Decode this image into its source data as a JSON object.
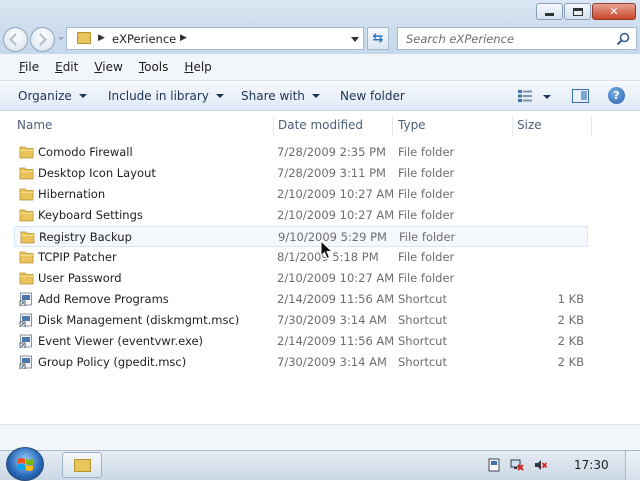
{
  "window": {
    "caption_buttons": [
      "minimize",
      "maximize",
      "close"
    ]
  },
  "address": {
    "path": "eXPerience",
    "search_placeholder": "Search eXPerience"
  },
  "menu": {
    "items": [
      {
        "label": "File",
        "accel": "F",
        "rest": "ile"
      },
      {
        "label": "Edit",
        "accel": "E",
        "rest": "dit"
      },
      {
        "label": "View",
        "accel": "V",
        "rest": "iew"
      },
      {
        "label": "Tools",
        "accel": "T",
        "rest": "ools"
      },
      {
        "label": "Help",
        "accel": "H",
        "rest": "elp"
      }
    ]
  },
  "commands": {
    "organize": "Organize",
    "include_in_library": "Include in library",
    "share_with": "Share with",
    "new_folder": "New folder"
  },
  "columns": {
    "name": "Name",
    "date_modified": "Date modified",
    "type": "Type",
    "size": "Size"
  },
  "files": [
    {
      "name": "Comodo Firewall",
      "date": "7/28/2009 2:35 PM",
      "type": "File folder",
      "size": "",
      "icon": "folder-icon"
    },
    {
      "name": "Desktop Icon Layout",
      "date": "7/28/2009 3:11 PM",
      "type": "File folder",
      "size": "",
      "icon": "folder-icon"
    },
    {
      "name": "Hibernation",
      "date": "2/10/2009 10:27 AM",
      "type": "File folder",
      "size": "",
      "icon": "folder-icon"
    },
    {
      "name": "Keyboard Settings",
      "date": "2/10/2009 10:27 AM",
      "type": "File folder",
      "size": "",
      "icon": "folder-icon"
    },
    {
      "name": "Registry Backup",
      "date": "9/10/2009 5:29 PM",
      "type": "File folder",
      "size": "",
      "icon": "folder-icon"
    },
    {
      "name": "TCPIP Patcher",
      "date": "8/1/2009 5:18 PM",
      "type": "File folder",
      "size": "",
      "icon": "folder-icon"
    },
    {
      "name": "User Password",
      "date": "2/10/2009 10:27 AM",
      "type": "File folder",
      "size": "",
      "icon": "folder-icon"
    },
    {
      "name": "Add Remove Programs",
      "date": "2/14/2009 11:56 AM",
      "type": "Shortcut",
      "size": "1 KB",
      "icon": "shortcut-icon"
    },
    {
      "name": "Disk Management (diskmgmt.msc)",
      "date": "7/30/2009 3:14 AM",
      "type": "Shortcut",
      "size": "2 KB",
      "icon": "shortcut-icon"
    },
    {
      "name": "Event Viewer (eventvwr.exe)",
      "date": "2/14/2009 11:56 AM",
      "type": "Shortcut",
      "size": "2 KB",
      "icon": "shortcut-icon"
    },
    {
      "name": "Group Policy (gpedit.msc)",
      "date": "7/30/2009 3:14 AM",
      "type": "Shortcut",
      "size": "2 KB",
      "icon": "shortcut-icon"
    }
  ],
  "hovered_row": "Registry Backup",
  "taskbar": {
    "clock": "17:30",
    "pinned": [
      "windows-explorer"
    ]
  },
  "colors": {
    "folder": "#e8c45b",
    "accent": "#2d70b9",
    "secondary_text": "#6d6d6d"
  }
}
